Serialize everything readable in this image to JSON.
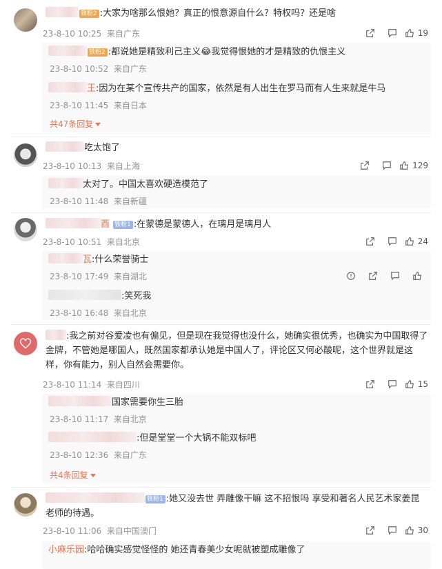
{
  "comments": [
    {
      "text": ":大家为啥那么恨她？真正的恨意源自什么？特权吗？还是啥",
      "badge": "铁粉2",
      "time": "23-8-10 10:25",
      "location": "来自广东",
      "likes": "19",
      "replies": [
        {
          "text": ":都说她是精致利己主义😂我觉得恨她的才是精致的仇恨主义",
          "badge": "铁粉2",
          "time": "23-8-10 10:52",
          "location": "来自广东"
        },
        {
          "name_tail": "王",
          "text": ":因为在某个宣传共产的国家，依然是有人出生在罗马而有人生来就是牛马",
          "time": "23-8-10 11:45",
          "location": "来自日本"
        }
      ],
      "more_replies": "共47条回复"
    },
    {
      "text": "吃太饱了",
      "time": "23-8-10 10:13",
      "location": "来自上海",
      "likes": "129",
      "replies": [
        {
          "text": "太对了。中国太喜欢硬造模范了",
          "time": "23-8-10 11:48",
          "location": "来自新疆"
        }
      ]
    },
    {
      "name_tail": "酉",
      "badge": "铁粉1",
      "text": ":在蒙德是蒙德人，在璃月是璃月人",
      "time": "23-8-10 10:51",
      "location": "来自北京",
      "likes": "24",
      "replies": [
        {
          "name_tail": "瓦",
          "text": ":什么荣誉骑士",
          "time": "23-8-10 17:49",
          "location": "来自湖北"
        },
        {
          "text": ":笑死我",
          "time": "23-8-10 16:48",
          "location": "来自北京"
        }
      ]
    },
    {
      "text": ":我之前对谷爱凌也有偏见，但是现在我觉得也没什么，她确实很优秀，也确实为中国取得了金牌，不管她是哪国人，既然国家都承认她是中国人了，评论区又何必酸呢，这个世界就是这样，你有能力，别人自然会需要你。",
      "time": "23-8-10 11:14",
      "location": "来自四川",
      "likes": "15",
      "replies": [
        {
          "text": "国家需要你生三胎",
          "time": "23-8-10 11:17",
          "location": "来自北京"
        },
        {
          "text": ":但是堂堂一个大锅不能双标吧",
          "time": "23-8-10 12:36",
          "location": "来自广东"
        }
      ],
      "more_replies": "共4条回复"
    },
    {
      "badge": "铁粉1",
      "text": ":她又没去世 弄雕像干嘛 这不招恨吗 享受和著名人民艺术家姜昆老师的待遇。",
      "time": "23-8-10 11:06",
      "location": "来自中国澳门",
      "likes": "30",
      "replies": [
        {
          "name": "小麻乐园",
          "text": ":哈哈确实感觉怪怪的 她还青春美少女呢就被塑成雕像了"
        }
      ]
    }
  ],
  "icons": {
    "share": "share-icon",
    "comment": "comment-icon",
    "like": "thumbs-up-icon",
    "report": "report-icon",
    "more": "chevron-down-icon"
  },
  "colors": {
    "accent": "#eb7350",
    "meta": "#939393",
    "badge_fan1": "#9bb5e8",
    "badge_fan2": "#f0a64a"
  }
}
